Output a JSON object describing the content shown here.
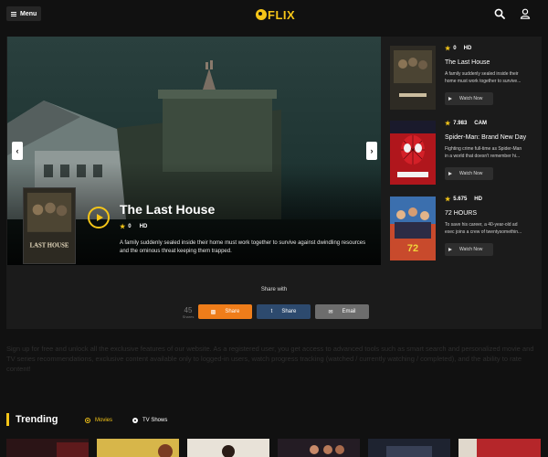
{
  "header": {
    "menu_label": "Menu",
    "logo_text": "FLIX",
    "icons": [
      "menu-icon",
      "search-icon",
      "user-icon"
    ]
  },
  "hero": {
    "title": "The Last House",
    "rating": "0",
    "quality": "HD",
    "description": "A family suddenly sealed inside their home must work together to survive against dwindling resources and the ominous threat keeping them trapped.",
    "poster_text": "LAST HOUSE"
  },
  "sidebar": {
    "items": [
      {
        "rating": "0",
        "quality": "HD",
        "title": "The Last House",
        "desc_line1": "A family suddenly sealed inside their",
        "desc_line2": "home must work together to survive...",
        "watch_label": "Watch Now"
      },
      {
        "rating": "7.983",
        "quality": "CAM",
        "title": "Spider-Man: Brand New Day",
        "desc_line1": "Fighting crime full-time as Spider-Man",
        "desc_line2": "in a world that doesn't remember hi...",
        "watch_label": "Watch Now"
      },
      {
        "rating": "5.675",
        "quality": "HD",
        "title": "72 HOURS",
        "desc_line1": "To save his career, a 40-year-old ad",
        "desc_line2": "exec joins a crew of twentysomethin...",
        "watch_label": "Watch Now"
      }
    ]
  },
  "share": {
    "heading": "Share with",
    "count": "45",
    "count_label": "Shares",
    "buttons": [
      "Share",
      "Share",
      "Email"
    ]
  },
  "info_text": "Sign up for free and unlock all the exclusive features of our website. As a registered user, you get access to advanced tools such as smart search and personalized movie and TV series recommendations, exclusive content available only to logged-in users, watch progress tracking (watched / currently watching / completed), and the ability to rate content!",
  "trending": {
    "title": "Trending",
    "tabs": [
      "Movies",
      "TV Shows"
    ],
    "active_tab": "Movies"
  },
  "colors": {
    "accent": "#f5c518",
    "share_orange": "#ef7d1a",
    "share_blue": "#2d4a6e",
    "share_gray": "#6d6d6d"
  }
}
